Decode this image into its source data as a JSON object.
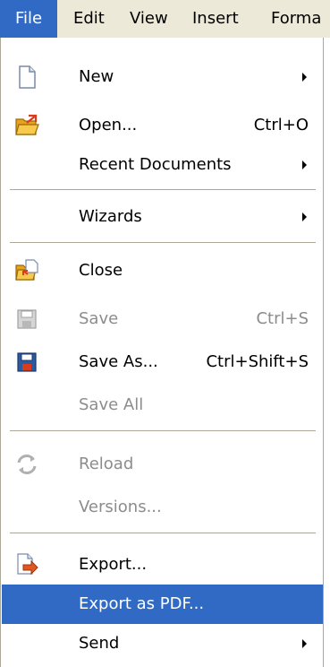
{
  "menubar": {
    "items": [
      {
        "label": "File"
      },
      {
        "label": "Edit"
      },
      {
        "label": "View"
      },
      {
        "label": "Insert"
      },
      {
        "label": "Forma"
      }
    ]
  },
  "file_menu": {
    "new": {
      "label": "New",
      "icon": "new-document-icon"
    },
    "open": {
      "label": "Open...",
      "shortcut": "Ctrl+O",
      "icon": "open-folder-icon"
    },
    "recent": {
      "label": "Recent Documents"
    },
    "wizards": {
      "label": "Wizards"
    },
    "close": {
      "label": "Close",
      "icon": "close-document-icon"
    },
    "save": {
      "label": "Save",
      "shortcut": "Ctrl+S",
      "icon": "save-disk-icon",
      "disabled": true
    },
    "save_as": {
      "label": "Save As...",
      "shortcut": "Ctrl+Shift+S",
      "icon": "save-as-disk-icon"
    },
    "save_all": {
      "label": "Save All",
      "disabled": true
    },
    "reload": {
      "label": "Reload",
      "icon": "reload-icon",
      "disabled": true
    },
    "versions": {
      "label": "Versions...",
      "disabled": true
    },
    "export": {
      "label": "Export...",
      "icon": "export-icon"
    },
    "export_pdf": {
      "label": "Export as PDF...",
      "selected": true
    },
    "send": {
      "label": "Send"
    }
  },
  "colors": {
    "highlight": "#316ac5",
    "menubar_bg": "#ece9d8",
    "disabled_text": "#8c8c8c",
    "separator": "#aca899"
  }
}
